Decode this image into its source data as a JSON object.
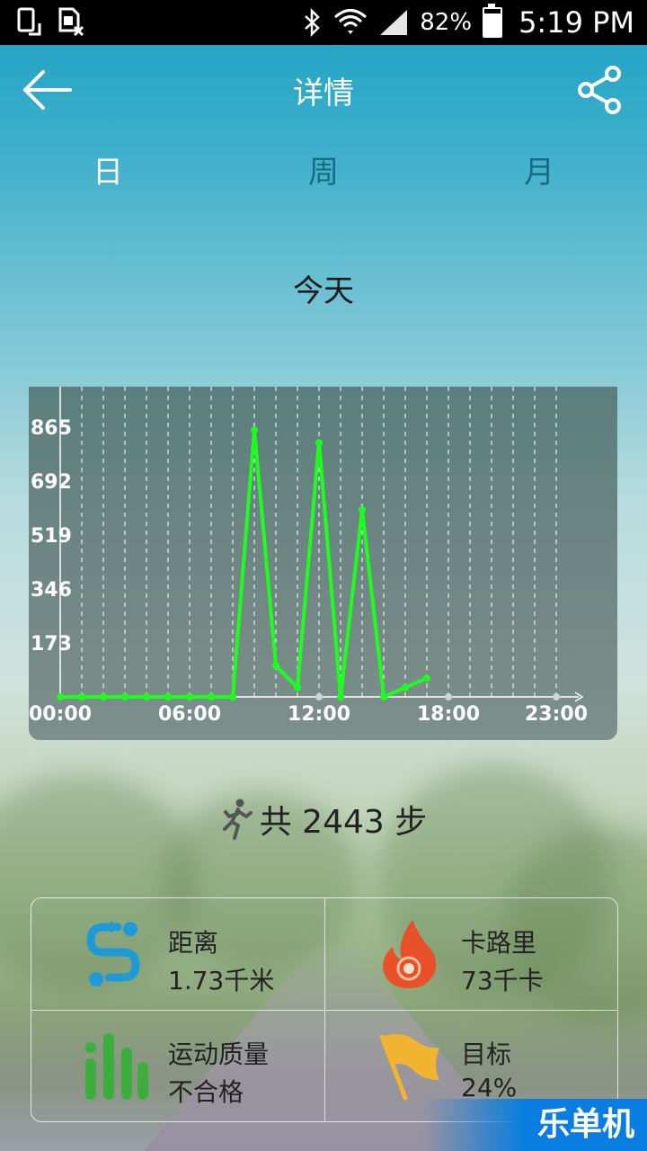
{
  "status_bar": {
    "battery_percent": "82%",
    "battery_level": 0.82,
    "time": "5:19 PM",
    "icons": [
      "screen-rotate-icon",
      "sim-error-icon",
      "bluetooth-icon",
      "wifi-icon",
      "signal-icon",
      "battery-icon"
    ]
  },
  "header": {
    "title": "详情",
    "back_icon": "arrow-left-icon",
    "share_icon": "share-icon"
  },
  "tabs": [
    {
      "label": "日",
      "active": true
    },
    {
      "label": "周",
      "active": false
    },
    {
      "label": "月",
      "active": false
    }
  ],
  "day_label": "今天",
  "chart_data": {
    "type": "line",
    "x_ticks": [
      "00:00",
      "06:00",
      "12:00",
      "18:00",
      "23:00"
    ],
    "y_ticks": [
      "865",
      "692",
      "519",
      "346",
      "173"
    ],
    "ylim": [
      0,
      865
    ],
    "xlim": [
      0,
      23
    ],
    "grid": "vertical dashed",
    "color": "#1cff1c",
    "series": [
      {
        "x": [
          0,
          1,
          2,
          3,
          4,
          5,
          6,
          7,
          8,
          9,
          10,
          11,
          12,
          13,
          14,
          15,
          16,
          17
        ],
        "values": [
          0,
          0,
          0,
          0,
          0,
          0,
          0,
          0,
          0,
          855,
          100,
          30,
          815,
          0,
          600,
          0,
          30,
          60
        ]
      }
    ]
  },
  "summary": {
    "icon": "running-person-icon",
    "prefix": "共",
    "steps": "2443",
    "unit": "步",
    "text": "共 2443 步"
  },
  "stats": [
    {
      "label": "距离",
      "value": "1.73千米",
      "icon": "distance-route-icon",
      "color": "#1e9ad6"
    },
    {
      "label": "卡路里",
      "value": "73千卡",
      "icon": "flame-icon",
      "color": "#e8502a"
    },
    {
      "label": "运动质量",
      "value": "不合格",
      "icon": "bar-quality-icon",
      "color": "#3cae3c"
    },
    {
      "label": "目标",
      "value": "24%",
      "icon": "goal-flag-icon",
      "color": "#f2b430"
    }
  ],
  "watermark": "乐单机"
}
